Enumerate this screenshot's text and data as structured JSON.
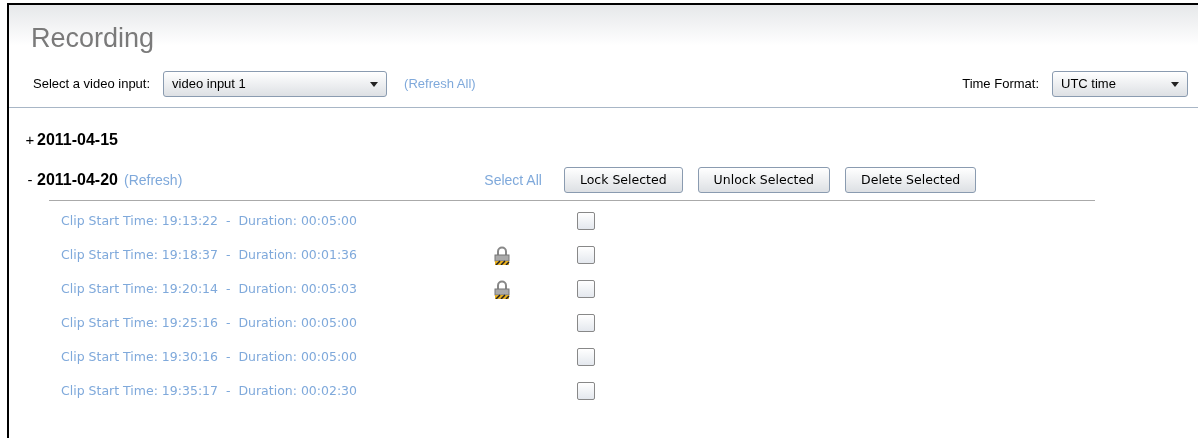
{
  "title": "Recording",
  "video_input": {
    "label": "Select a video input:",
    "value": "video input 1"
  },
  "refresh_all": "(Refresh All)",
  "time_format": {
    "label": "Time Format:",
    "value": "UTC time"
  },
  "dates": [
    {
      "toggle": "+",
      "date": "2011-04-15"
    },
    {
      "toggle": "-",
      "date": "2011-04-20",
      "refresh": "(Refresh)",
      "select_all": "Select All",
      "buttons": [
        "Lock Selected",
        "Unlock Selected",
        "Delete Selected"
      ],
      "clips": [
        {
          "text": "Clip Start Time: 19:13:22  -  Duration: 00:05:00",
          "locked": false,
          "checked": false
        },
        {
          "text": "Clip Start Time: 19:18:37  -  Duration: 00:01:36",
          "locked": true,
          "checked": false
        },
        {
          "text": "Clip Start Time: 19:20:14  -  Duration: 00:05:03",
          "locked": true,
          "checked": false
        },
        {
          "text": "Clip Start Time: 19:25:16  -  Duration: 00:05:00",
          "locked": false,
          "checked": false
        },
        {
          "text": "Clip Start Time: 19:30:16  -  Duration: 00:05:00",
          "locked": false,
          "checked": false
        },
        {
          "text": "Clip Start Time: 19:35:17  -  Duration: 00:02:30",
          "locked": false,
          "checked": false
        }
      ]
    }
  ]
}
